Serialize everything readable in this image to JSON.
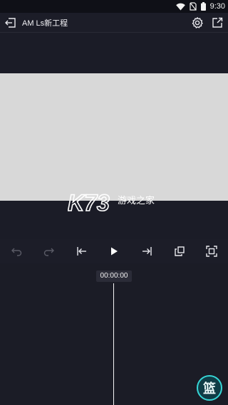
{
  "status_bar": {
    "time": "9:30"
  },
  "app_bar": {
    "title": "AM Ls新工程"
  },
  "watermark": {
    "logo_text": "K73",
    "subtitle": "游戏之家"
  },
  "timeline": {
    "timecode": "00:00:00"
  },
  "fab": {
    "glyph": "篮"
  },
  "colors": {
    "background": "#1b1c26",
    "preview_canvas": "#d8d8d8",
    "accent_teal": "#37d6d6",
    "playhead": "#f5f5f5",
    "disabled_icon": "#5a5b66"
  },
  "icons": [
    "back-icon",
    "settings-icon",
    "export-icon",
    "undo-icon",
    "redo-icon",
    "skip-to-start-icon",
    "play-icon",
    "skip-to-end-icon",
    "crop-icon",
    "fullscreen-icon"
  ]
}
